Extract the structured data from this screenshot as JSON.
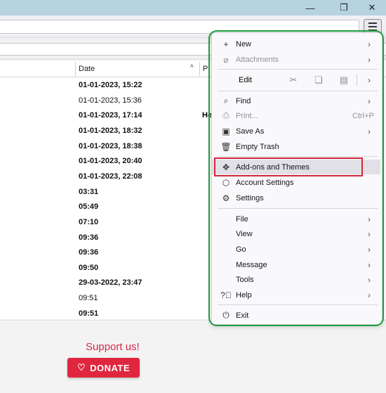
{
  "window": {
    "minimize_icon": "minimize-icon",
    "restore_icon": "restore-icon",
    "close_icon": "close-icon"
  },
  "list": {
    "header": {
      "date": "Date",
      "next_col": "Pi"
    },
    "rows": [
      {
        "date": "01-01-2023, 15:22",
        "unread": true,
        "extra": ""
      },
      {
        "date": "01-01-2023, 15:36",
        "unread": false,
        "extra": ""
      },
      {
        "date": "01-01-2023, 17:14",
        "unread": true,
        "extra": "He"
      },
      {
        "date": "01-01-2023, 18:32",
        "unread": true,
        "extra": ""
      },
      {
        "date": "01-01-2023, 18:38",
        "unread": true,
        "extra": ""
      },
      {
        "date": "01-01-2023, 20:40",
        "unread": true,
        "extra": ""
      },
      {
        "date": "01-01-2023, 22:08",
        "unread": true,
        "extra": ""
      },
      {
        "date": "03:31",
        "unread": true,
        "extra": ""
      },
      {
        "date": "05:49",
        "unread": true,
        "extra": ""
      },
      {
        "date": "07:10",
        "unread": true,
        "extra": ""
      },
      {
        "date": "09:36",
        "unread": true,
        "extra": ""
      },
      {
        "date": "09:36",
        "unread": true,
        "extra": ""
      },
      {
        "date": "09:50",
        "unread": true,
        "extra": ""
      },
      {
        "date": "29-03-2022, 23:47",
        "unread": true,
        "extra": ""
      },
      {
        "date": "09:51",
        "unread": false,
        "extra": ""
      },
      {
        "date": "09:51",
        "unread": true,
        "extra": ""
      }
    ]
  },
  "footer": {
    "support": "Support us!",
    "donate": "DONATE"
  },
  "menu": {
    "new": "New",
    "attachments": "Attachments",
    "edit": "Edit",
    "find": "Find",
    "print": "Print...",
    "print_shortcut": "Ctrl+P",
    "save_as": "Save As",
    "empty_trash": "Empty Trash",
    "addons": "Add-ons and Themes",
    "account_settings": "Account Settings",
    "settings": "Settings",
    "file": "File",
    "view": "View",
    "go": "Go",
    "message": "Message",
    "tools": "Tools",
    "help": "Help",
    "exit": "Exit"
  },
  "colors": {
    "titlebar": "#b7d3e0",
    "highlight_outline": "#1c9e3d",
    "red_box": "#d2283a",
    "donate_bg": "#e0263f",
    "support_text": "#d6274a"
  }
}
